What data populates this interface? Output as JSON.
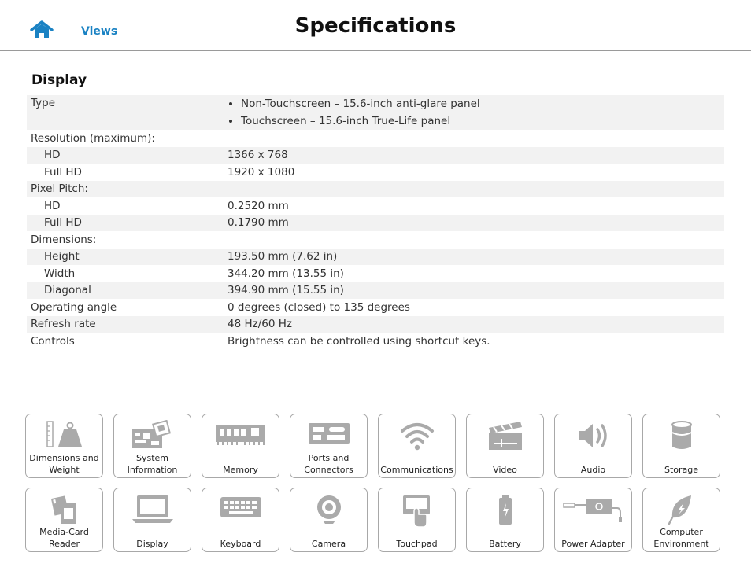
{
  "header": {
    "home_icon": "home-icon",
    "views_link": "Views",
    "title": "Specifications"
  },
  "section_title": "Display",
  "spec": {
    "type_label": "Type",
    "type_values": [
      "Non-Touchscreen – 15.6-inch anti-glare panel",
      "Touchscreen – 15.6-inch True-Life panel"
    ],
    "resolution_label": "Resolution (maximum):",
    "res_hd_label": "HD",
    "res_hd_value": "1366 x 768",
    "res_fhd_label": "Full HD",
    "res_fhd_value": "1920 x 1080",
    "pixel_label": "Pixel Pitch:",
    "pix_hd_label": "HD",
    "pix_hd_value": "0.2520 mm",
    "pix_fhd_label": "Full HD",
    "pix_fhd_value": "0.1790 mm",
    "dimensions_label": "Dimensions:",
    "height_label": "Height",
    "height_value": "193.50 mm (7.62 in)",
    "width_label": "Width",
    "width_value": "344.20 mm (13.55 in)",
    "diagonal_label": "Diagonal",
    "diagonal_value": "394.90 mm (15.55 in)",
    "angle_label": "Operating angle",
    "angle_value": "0 degrees (closed) to 135 degrees",
    "refresh_label": "Refresh rate",
    "refresh_value": "48 Hz/60 Hz",
    "controls_label": "Controls",
    "controls_value": "Brightness can be controlled using shortcut keys."
  },
  "nav": {
    "row1": [
      "Dimensions and Weight",
      "System Information",
      "Memory",
      "Ports and Connectors",
      "Communications",
      "Video",
      "Audio",
      "Storage"
    ],
    "row2": [
      "Media-Card Reader",
      "Display",
      "Keyboard",
      "Camera",
      "Touchpad",
      "Battery",
      "Power Adapter",
      "Computer Environment"
    ]
  },
  "colors": {
    "accent": "#1a82c3",
    "icon_gray": "#a8a8a8",
    "row_shade": "#f2f2f2"
  }
}
